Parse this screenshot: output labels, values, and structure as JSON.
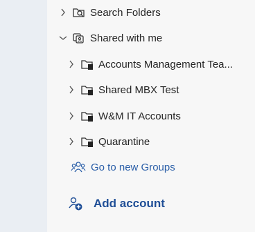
{
  "folders": {
    "search_folders": "Search Folders",
    "shared_with_me": "Shared with me",
    "shared_items": [
      {
        "label": "Accounts Management Tea..."
      },
      {
        "label": "Shared MBX Test"
      },
      {
        "label": "W&M IT Accounts"
      },
      {
        "label": "Quarantine"
      }
    ]
  },
  "links": {
    "go_to_groups": "Go to new Groups",
    "add_account": "Add account"
  },
  "colors": {
    "text": "#242424",
    "link": "#2b5fa8",
    "add_account": "#1f4e96",
    "rail_bg": "#eaeef3"
  },
  "icons": {
    "chevron_right": "chevron-right-icon",
    "chevron_down": "chevron-down-icon",
    "search_folder": "search-folder-icon",
    "shared": "shared-folder-icon",
    "folder_person": "shared-mailbox-folder-icon",
    "groups": "groups-icon",
    "add_person": "add-person-icon"
  }
}
